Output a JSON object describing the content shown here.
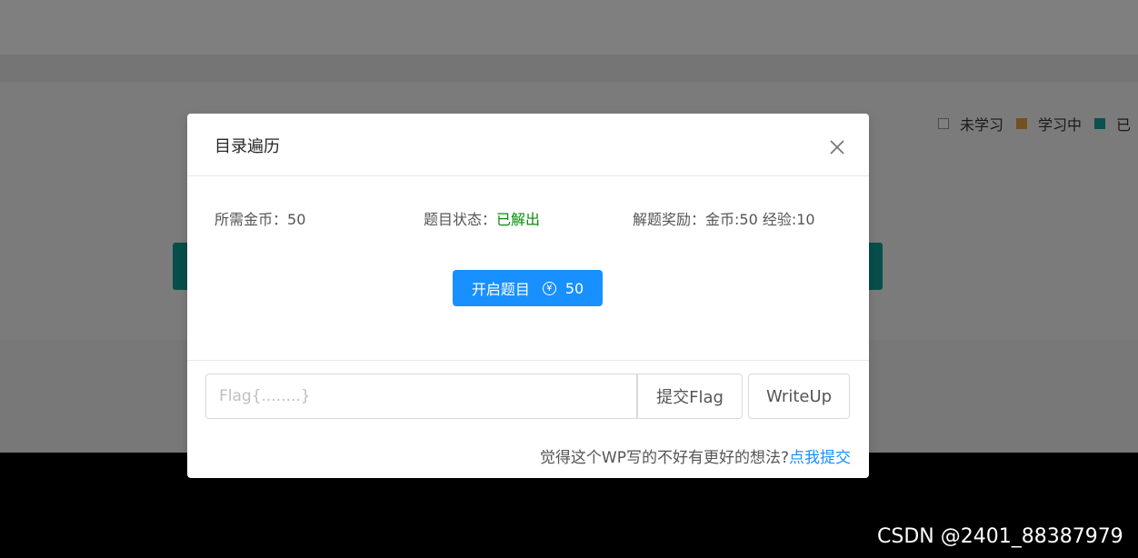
{
  "legend": {
    "items": [
      {
        "label": "未学习",
        "color": "#ffffff"
      },
      {
        "label": "学习中",
        "color": "#e6a23c"
      },
      {
        "label": "已",
        "color": "#14a2a0"
      }
    ]
  },
  "modal": {
    "title": "目录遍历",
    "close_icon": "close-icon",
    "required_coins_label": "所需金币：",
    "required_coins_value": "50",
    "status_label": "题目状态：",
    "status_value": "已解出",
    "reward_text": "解题奖励：金币:50 经验:10",
    "start_button_label": "开启题目",
    "start_button_cost": "50",
    "coin_icon": "yen-coin-icon",
    "flag_placeholder": "Flag{........}",
    "flag_value": "",
    "submit_label": "提交Flag",
    "writeup_label": "WriteUp",
    "feedback_text": "觉得这个WP写的不好有更好的想法?",
    "feedback_link": "点我提交"
  },
  "watermark": "CSDN @2401_88387979",
  "colors": {
    "primary": "#1890ff",
    "solved": "#0a8a0a",
    "card_teal": "#0e9f95"
  }
}
